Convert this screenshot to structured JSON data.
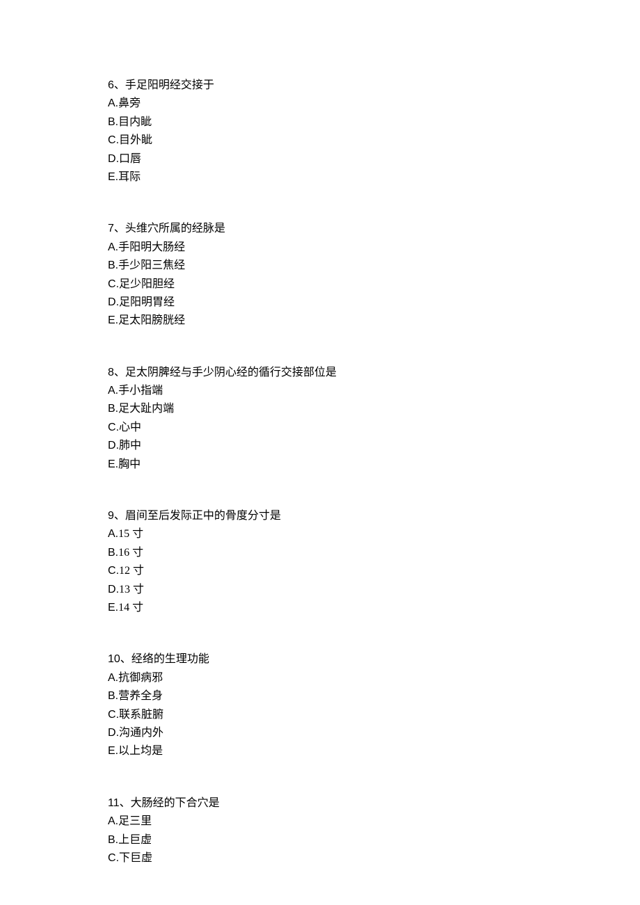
{
  "questions": [
    {
      "number": "6",
      "stem": "手足阳明经交接于",
      "options": [
        {
          "letter": "A",
          "text": "鼻旁"
        },
        {
          "letter": "B",
          "text": "目内眦"
        },
        {
          "letter": "C",
          "text": "目外眦"
        },
        {
          "letter": "D",
          "text": "口唇"
        },
        {
          "letter": "E",
          "text": "耳际"
        }
      ]
    },
    {
      "number": "7",
      "stem": "头维穴所属的经脉是",
      "options": [
        {
          "letter": "A",
          "text": "手阳明大肠经"
        },
        {
          "letter": "B",
          "text": "手少阳三焦经"
        },
        {
          "letter": "C",
          "text": "足少阳胆经"
        },
        {
          "letter": "D",
          "text": "足阳明胃经"
        },
        {
          "letter": "E",
          "text": "足太阳膀胱经"
        }
      ]
    },
    {
      "number": "8",
      "stem": "足太阴脾经与手少阴心经的循行交接部位是",
      "options": [
        {
          "letter": "A",
          "text": "手小指端"
        },
        {
          "letter": "B",
          "text": "足大趾内端"
        },
        {
          "letter": "C",
          "text": "心中"
        },
        {
          "letter": "D",
          "text": "肺中"
        },
        {
          "letter": "E",
          "text": "胸中"
        }
      ]
    },
    {
      "number": "9",
      "stem": "眉间至后发际正中的骨度分寸是",
      "options": [
        {
          "letter": "A",
          "text": "15 寸"
        },
        {
          "letter": "B",
          "text": "16 寸"
        },
        {
          "letter": "C",
          "text": "12 寸"
        },
        {
          "letter": "D",
          "text": "13 寸"
        },
        {
          "letter": "E",
          "text": "14 寸"
        }
      ]
    },
    {
      "number": "10",
      "stem": "经络的生理功能",
      "options": [
        {
          "letter": "A",
          "text": "抗御病邪"
        },
        {
          "letter": "B",
          "text": "营养全身"
        },
        {
          "letter": "C",
          "text": "联系脏腑"
        },
        {
          "letter": "D",
          "text": "沟通内外"
        },
        {
          "letter": "E",
          "text": "以上均是"
        }
      ]
    },
    {
      "number": "11",
      "stem": "大肠经的下合穴是",
      "options": [
        {
          "letter": "A",
          "text": "足三里"
        },
        {
          "letter": "B",
          "text": "上巨虚"
        },
        {
          "letter": "C",
          "text": "下巨虚"
        }
      ]
    }
  ],
  "separator": "、",
  "dot": "."
}
